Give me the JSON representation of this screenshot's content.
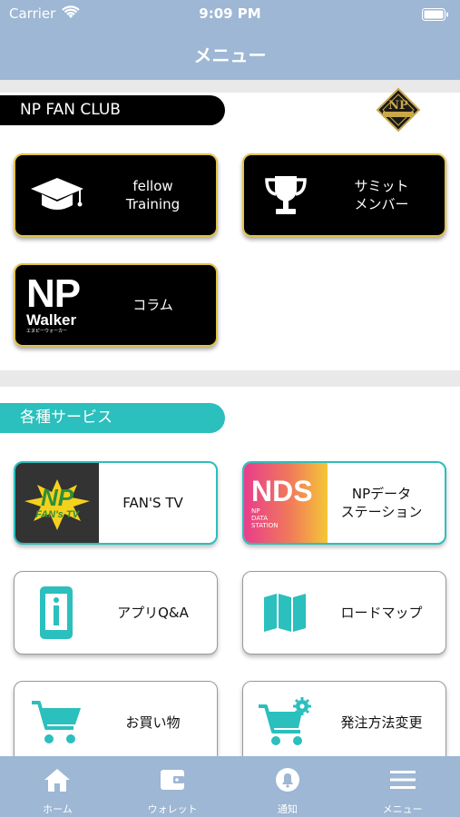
{
  "status": {
    "carrier": "Carrier",
    "time": "9:09 PM"
  },
  "nav": {
    "title": "メニュー"
  },
  "fan_club": {
    "header": "NP FAN CLUB",
    "logo_text": "NP",
    "cards": [
      {
        "label": "fellow\nTraining",
        "icon": "graduation-cap-icon"
      },
      {
        "label": "サミット\nメンバー",
        "icon": "trophy-icon"
      },
      {
        "label": "コラム",
        "icon": "np-walker-logo"
      }
    ],
    "walker_np": "NP",
    "walker_word": "Walker",
    "walker_sub": "エヌピーウォーカー"
  },
  "services": {
    "header": "各種サービス",
    "cards": [
      {
        "label": "FAN'S TV",
        "icon": "fans-tv-logo"
      },
      {
        "label": "NPデータ\nステーション",
        "icon": "nds-logo"
      },
      {
        "label": "アプリQ&A",
        "icon": "info-phone-icon"
      },
      {
        "label": "ロードマップ",
        "icon": "map-icon"
      },
      {
        "label": "お買い物",
        "icon": "cart-icon"
      },
      {
        "label": "発注方法変更",
        "icon": "cart-gear-icon"
      }
    ],
    "fanstv_np": "NP",
    "fanstv_sub": "FAN's TV",
    "nds_big": "NDS",
    "nds_sub": "NP\nDATA\nSTATION"
  },
  "tabs": [
    {
      "label": "ホーム",
      "icon": "home-icon"
    },
    {
      "label": "ウォレット",
      "icon": "wallet-icon"
    },
    {
      "label": "通知",
      "icon": "bell-icon"
    },
    {
      "label": "メニュー",
      "icon": "hamburger-icon"
    }
  ],
  "colors": {
    "bar": "#9db7d4",
    "teal": "#2bbfbd",
    "gold": "#e2c248"
  }
}
